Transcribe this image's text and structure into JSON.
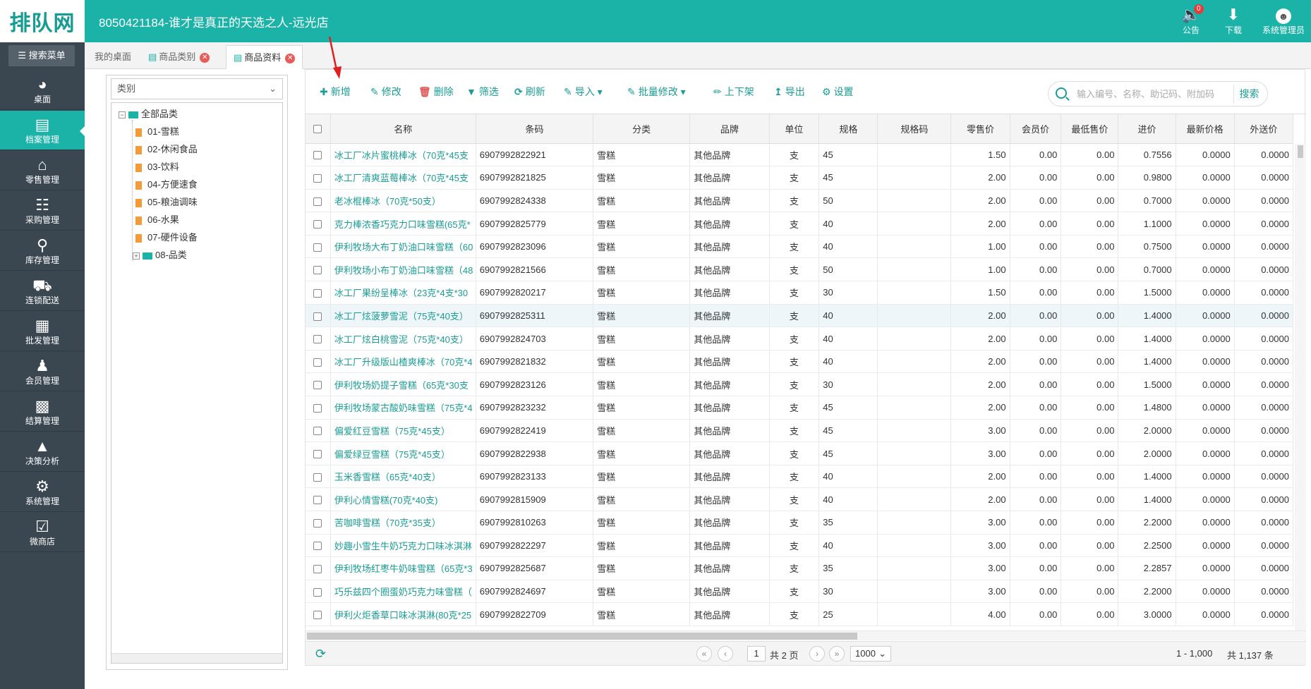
{
  "header": {
    "logo": "排队网",
    "store_title": "8050421184-谁才是真正的天选之人-远光店",
    "actions": [
      {
        "label": "公告",
        "icon": "speaker-icon",
        "badge": "0"
      },
      {
        "label": "下载",
        "icon": "download-icon"
      },
      {
        "label": "系统管理员",
        "icon": "avatar"
      }
    ]
  },
  "sidebar": {
    "search_label": "搜索菜单",
    "items": [
      {
        "label": "桌面",
        "icon": "dashboard-icon"
      },
      {
        "label": "档案管理",
        "icon": "archive-icon",
        "active": true
      },
      {
        "label": "零售管理",
        "icon": "store-icon"
      },
      {
        "label": "采购管理",
        "icon": "cart-icon"
      },
      {
        "label": "库存管理",
        "icon": "inventory-icon"
      },
      {
        "label": "连锁配送",
        "icon": "truck-icon"
      },
      {
        "label": "批发管理",
        "icon": "wholesale-icon"
      },
      {
        "label": "会员管理",
        "icon": "member-icon"
      },
      {
        "label": "结算管理",
        "icon": "settlement-icon"
      },
      {
        "label": "决策分析",
        "icon": "analysis-icon"
      },
      {
        "label": "系统管理",
        "icon": "gear-icon"
      },
      {
        "label": "微商店",
        "icon": "shop-bag-icon"
      }
    ]
  },
  "tabs": [
    {
      "label": "我的桌面",
      "closable": false
    },
    {
      "label": "商品类别",
      "closable": true
    },
    {
      "label": "商品资料",
      "closable": true,
      "active": true
    }
  ],
  "category_tree": {
    "select_placeholder": "类别",
    "root": "全部品类",
    "children": [
      "01-雪糕",
      "02-休闲食品",
      "03-饮料",
      "04-方便速食",
      "05-粮油调味",
      "06-水果",
      "07-硬件设备",
      "08-品类"
    ]
  },
  "toolbar": {
    "add": "新增",
    "edit": "修改",
    "delete": "删除",
    "filter": "筛选",
    "refresh": "刷新",
    "import": "导入",
    "batch_edit": "批量修改",
    "shelf": "上下架",
    "export": "导出",
    "settings": "设置",
    "search_placeholder": "输入编号、名称、助记码、附加码",
    "search_button": "搜索"
  },
  "table": {
    "columns": [
      "名称",
      "条码",
      "分类",
      "品牌",
      "单位",
      "规格",
      "规格码",
      "零售价",
      "会员价",
      "最低售价",
      "进价",
      "最新价格",
      "外送价"
    ],
    "rows": [
      [
        "冰工厂冰片蜜桃棒冰（70克*45支",
        "6907992822921",
        "雪糕",
        "其他品牌",
        "支",
        "45",
        "",
        "1.50",
        "0.00",
        "0.00",
        "0.7556",
        "0.0000",
        "0.0000"
      ],
      [
        "冰工厂清爽蓝莓棒冰（70克*45支",
        "6907992821825",
        "雪糕",
        "其他品牌",
        "支",
        "45",
        "",
        "2.00",
        "0.00",
        "0.00",
        "0.9800",
        "0.0000",
        "0.0000"
      ],
      [
        "老冰棍棒冰（70克*50支）",
        "6907992824338",
        "雪糕",
        "其他品牌",
        "支",
        "50",
        "",
        "2.00",
        "0.00",
        "0.00",
        "0.7000",
        "0.0000",
        "0.0000"
      ],
      [
        "克力棒浓香巧克力口味雪糕(65克*",
        "6907992825779",
        "雪糕",
        "其他品牌",
        "支",
        "40",
        "",
        "2.00",
        "0.00",
        "0.00",
        "1.1000",
        "0.0000",
        "0.0000"
      ],
      [
        "伊利牧场大布丁奶油口味雪糕（60",
        "6907992823096",
        "雪糕",
        "其他品牌",
        "支",
        "40",
        "",
        "1.00",
        "0.00",
        "0.00",
        "0.7500",
        "0.0000",
        "0.0000"
      ],
      [
        "伊利牧场小布丁奶油口味雪糕（48",
        "6907992821566",
        "雪糕",
        "其他品牌",
        "支",
        "50",
        "",
        "1.00",
        "0.00",
        "0.00",
        "0.7000",
        "0.0000",
        "0.0000"
      ],
      [
        "冰工厂果纷呈棒冰（23克*4支*30",
        "6907992820217",
        "雪糕",
        "其他品牌",
        "支",
        "30",
        "",
        "1.50",
        "0.00",
        "0.00",
        "1.5000",
        "0.0000",
        "0.0000"
      ],
      [
        "冰工厂炫菠萝雪泥（75克*40支）",
        "6907992825311",
        "雪糕",
        "其他品牌",
        "支",
        "40",
        "",
        "2.00",
        "0.00",
        "0.00",
        "1.4000",
        "0.0000",
        "0.0000"
      ],
      [
        "冰工厂炫白桃雪泥（75克*40支）",
        "6907992824703",
        "雪糕",
        "其他品牌",
        "支",
        "40",
        "",
        "2.00",
        "0.00",
        "0.00",
        "1.4000",
        "0.0000",
        "0.0000"
      ],
      [
        "冰工厂升级版山楂爽棒冰（70克*4",
        "6907992821832",
        "雪糕",
        "其他品牌",
        "支",
        "40",
        "",
        "2.00",
        "0.00",
        "0.00",
        "1.4000",
        "0.0000",
        "0.0000"
      ],
      [
        "伊利牧场奶提子雪糕（65克*30支",
        "6907992823126",
        "雪糕",
        "其他品牌",
        "支",
        "30",
        "",
        "2.00",
        "0.00",
        "0.00",
        "1.5000",
        "0.0000",
        "0.0000"
      ],
      [
        "伊利牧场蒙古酸奶味雪糕（75克*4",
        "6907992823232",
        "雪糕",
        "其他品牌",
        "支",
        "45",
        "",
        "2.00",
        "0.00",
        "0.00",
        "1.4800",
        "0.0000",
        "0.0000"
      ],
      [
        "偏爱红豆雪糕（75克*45支）",
        "6907992822419",
        "雪糕",
        "其他品牌",
        "支",
        "45",
        "",
        "3.00",
        "0.00",
        "0.00",
        "2.0000",
        "0.0000",
        "0.0000"
      ],
      [
        "偏爱绿豆雪糕（75克*45支）",
        "6907992822938",
        "雪糕",
        "其他品牌",
        "支",
        "45",
        "",
        "3.00",
        "0.00",
        "0.00",
        "2.0000",
        "0.0000",
        "0.0000"
      ],
      [
        "玉米香雪糕（65克*40支）",
        "6907992823133",
        "雪糕",
        "其他品牌",
        "支",
        "40",
        "",
        "2.00",
        "0.00",
        "0.00",
        "1.4000",
        "0.0000",
        "0.0000"
      ],
      [
        "伊利心情雪糕(70克*40支)",
        "6907992815909",
        "雪糕",
        "其他品牌",
        "支",
        "40",
        "",
        "2.00",
        "0.00",
        "0.00",
        "1.4000",
        "0.0000",
        "0.0000"
      ],
      [
        "苦咖啡雪糕（70克*35支）",
        "6907992810263",
        "雪糕",
        "其他品牌",
        "支",
        "35",
        "",
        "3.00",
        "0.00",
        "0.00",
        "2.2000",
        "0.0000",
        "0.0000"
      ],
      [
        "妙趣小雪生牛奶巧克力口味冰淇淋",
        "6907992822297",
        "雪糕",
        "其他品牌",
        "支",
        "40",
        "",
        "3.00",
        "0.00",
        "0.00",
        "2.2500",
        "0.0000",
        "0.0000"
      ],
      [
        "伊利牧场红枣牛奶味雪糕（65克*3",
        "6907992825687",
        "雪糕",
        "其他品牌",
        "支",
        "35",
        "",
        "3.00",
        "0.00",
        "0.00",
        "2.2857",
        "0.0000",
        "0.0000"
      ],
      [
        "巧乐兹四个圈蛋奶巧克力味雪糕（",
        "6907992824697",
        "雪糕",
        "其他品牌",
        "支",
        "30",
        "",
        "3.00",
        "0.00",
        "0.00",
        "2.2000",
        "0.0000",
        "0.0000"
      ],
      [
        "伊利火炬香草口味冰淇淋(80克*25",
        "6907992822709",
        "雪糕",
        "其他品牌",
        "支",
        "25",
        "",
        "4.00",
        "0.00",
        "0.00",
        "3.0000",
        "0.0000",
        "0.0000"
      ]
    ],
    "highlighted_row": 7
  },
  "pager": {
    "current_page": "1",
    "total_pages": "共 2 页",
    "page_size": "1000",
    "range": "1 - 1,000",
    "total": "共 1,137 条"
  },
  "colors": {
    "accent": "#1bb2a8",
    "sidebar": "#3a4650",
    "link": "#1a9d94",
    "arrow": "#e02020"
  }
}
